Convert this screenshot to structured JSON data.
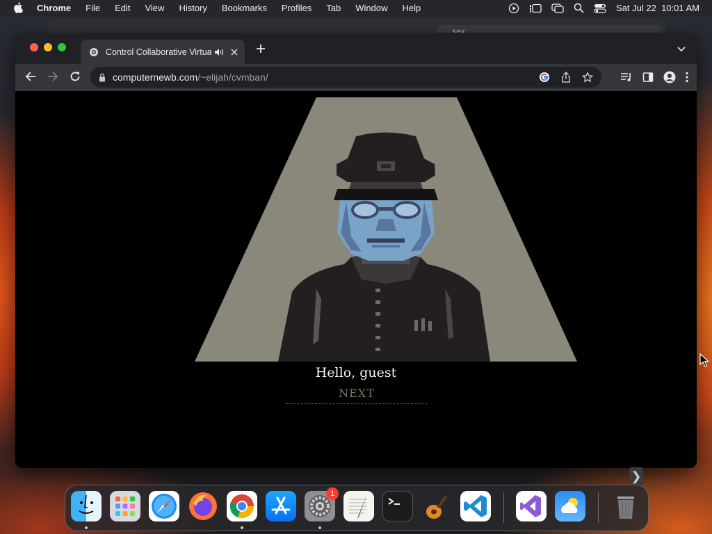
{
  "menubar": {
    "app_name": "Chrome",
    "items": [
      "File",
      "Edit",
      "View",
      "History",
      "Bookmarks",
      "Profiles",
      "Tab",
      "Window",
      "Help"
    ],
    "clock": "Sat Jul 22  10:01 AM"
  },
  "background_window": {
    "search_text": "sex"
  },
  "browser": {
    "tab_title": "Control Collaborative Virtual",
    "url_host": "computernewb.com",
    "url_path": "/~elijah/cvmban/"
  },
  "page": {
    "greeting": "Hello, guest",
    "next_label": "NEXT"
  },
  "desktop": {
    "side_arrow": "❯"
  },
  "dock": {
    "apps": [
      "finder",
      "launchpad",
      "safari",
      "firefox",
      "chrome",
      "app-store",
      "system-settings",
      "textedit",
      "terminal",
      "garageband",
      "vscode",
      "visual-studio",
      "weather",
      "trash"
    ],
    "settings_badge": "1"
  },
  "colors": {
    "spotlight": "#8a877b",
    "face": "#7aa3c8",
    "next_text": "#6f7a66"
  }
}
